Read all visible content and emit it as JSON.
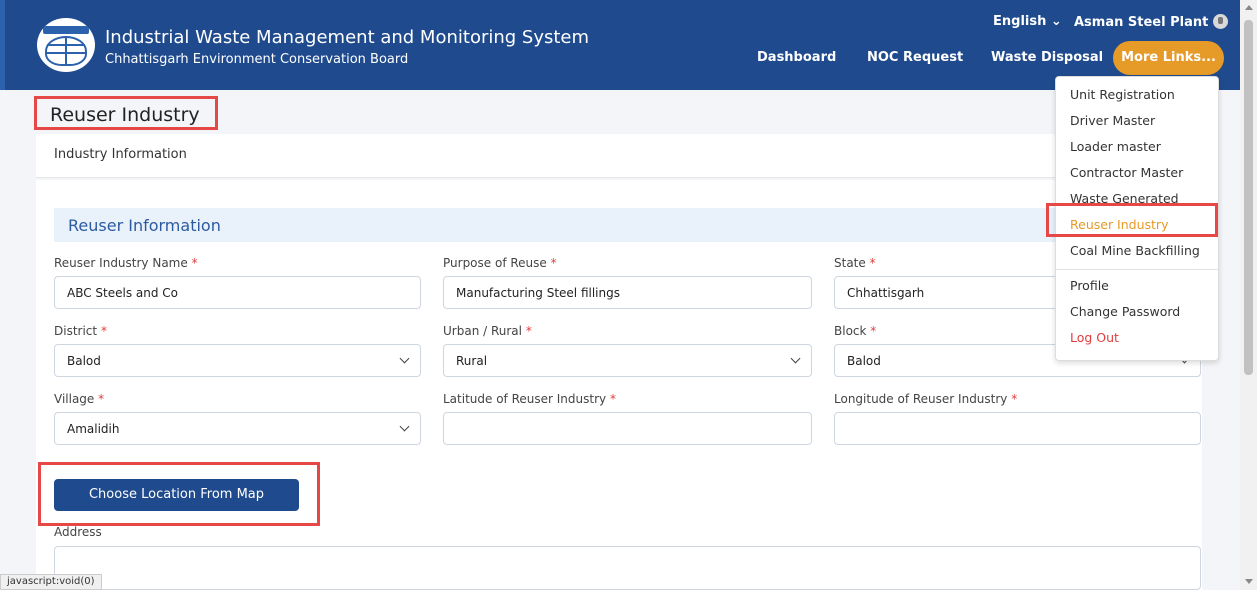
{
  "header": {
    "title": "Industrial Waste Management and Monitoring System",
    "subtitle": "Chhattisgarh Environment Conservation Board",
    "language": "English ⌄",
    "user_name": "Asman Steel Plant",
    "nav": {
      "dashboard": "Dashboard",
      "noc_request": "NOC Request",
      "waste_disposal": "Waste Disposal",
      "more_links": "More Links..."
    }
  },
  "page": {
    "title": "Reuser Industry",
    "card_header": "Industry Information",
    "section_title": "Reuser Information"
  },
  "form": {
    "reuser_name": {
      "label": "Reuser Industry Name",
      "value": "ABC Steels and Co"
    },
    "purpose": {
      "label": "Purpose of Reuse",
      "value": "Manufacturing Steel fillings"
    },
    "state": {
      "label": "State",
      "value": "Chhattisgarh"
    },
    "district": {
      "label": "District",
      "value": "Balod"
    },
    "urban_rural": {
      "label": "Urban / Rural",
      "value": "Rural"
    },
    "block": {
      "label": "Block",
      "value": "Balod"
    },
    "village": {
      "label": "Village",
      "value": "Amalidih"
    },
    "latitude": {
      "label": "Latitude of Reuser Industry",
      "value": ""
    },
    "longitude": {
      "label": "Longitude of Reuser Industry",
      "value": ""
    },
    "required_mark": "*",
    "map_button": "Choose Location From Map",
    "address_label": "Address",
    "address_value": ""
  },
  "dropdown": {
    "items": [
      "Unit Registration",
      "Driver Master",
      "Loader master",
      "Contractor Master",
      "Waste Generated",
      "Reuser Industry",
      "Coal Mine Backfilling",
      "Profile",
      "Change Password",
      "Log Out"
    ]
  },
  "status_bar": "javascript:void(0)",
  "colors": {
    "header_bg": "#1f4b8e",
    "more_links_bg": "#e69a28",
    "active_menu": "#e69a28",
    "logout": "#e23d3d",
    "highlight_box": "#e64848"
  }
}
